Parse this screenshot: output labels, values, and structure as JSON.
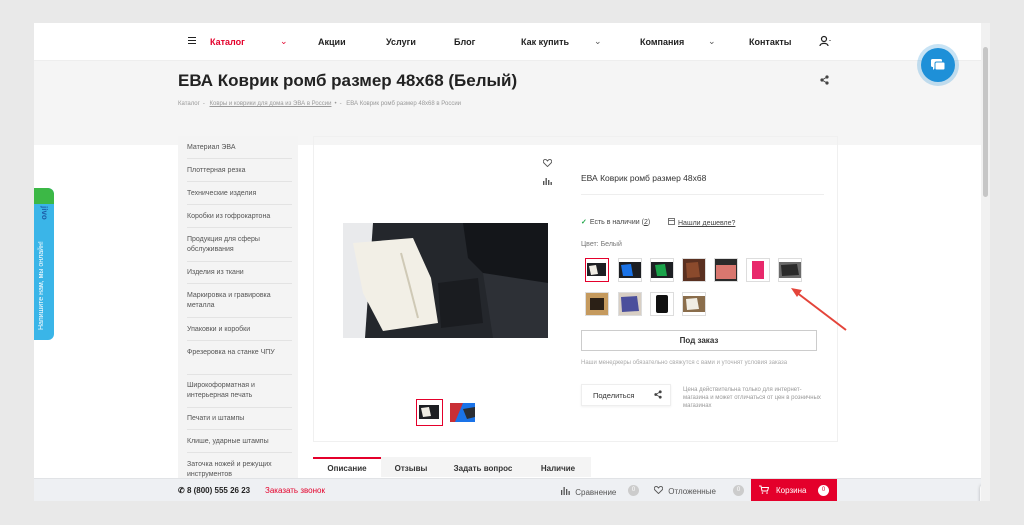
{
  "nav": {
    "catalog": "Каталог",
    "items": [
      "Акции",
      "Услуги",
      "Блог",
      "Как купить",
      "Компания",
      "Контакты"
    ]
  },
  "header": {
    "title": "ЕВА Коврик ромб размер 48х68 (Белый)",
    "breadcrumbs": [
      "Каталог",
      "Ковры и коврики для дома из ЭВА в России",
      "ЕВА Коврик ромб размер 48х68 в России"
    ]
  },
  "sidebar": {
    "items": [
      "Материал ЭВА",
      "Плоттерная резка",
      "Технические изделия",
      "Коробки из гофрокартона",
      "Продукция для сферы обслуживания",
      "Изделия из ткани",
      "Маркировка и гравировка металла",
      "Упаковки и коробки",
      "Фрезеровка на станке ЧПУ",
      "Широкоформатная и интерьерная печать",
      "Печати и штампы",
      "Клише, ударные штампы",
      "Заточка ножей и режущих инструментов"
    ]
  },
  "product": {
    "name": "ЕВА Коврик ромб размер 48х68",
    "stock": "Есть в наличии",
    "stock_count": "2",
    "cheaper": "Нашли дешевле?",
    "color_label": "Цвет: Белый",
    "order_button": "Под заказ",
    "manager_note": "Наши менеджеры обязательно свяжутся с вами и уточнят условия заказа",
    "share": "Поделиться",
    "price_note": "Цена действительна только для интернет-магазина и может отличаться от цен в розничных магазинах",
    "swatch_colors": [
      "#ffffff",
      "#1a73e8",
      "#1aa34a",
      "#8b4a2c",
      "#d9776f",
      "#e8296b",
      "#2b2b2b",
      "#c59a5e",
      "#4b4f9c",
      "#111111",
      "#8a6d4b"
    ]
  },
  "tabs": [
    "Описание",
    "Отзывы",
    "Задать вопрос",
    "Наличие"
  ],
  "bottom": {
    "phone": "8 (800) 555 26 23",
    "callback": "Заказать звонок",
    "compare": "Сравнение",
    "compare_count": "0",
    "deferred": "Отложенные",
    "deferred_count": "0",
    "cart": "Корзина",
    "cart_count": "0"
  },
  "jivo": {
    "text": "Напишите нам, мы онлайн!",
    "brand": "jivo"
  }
}
